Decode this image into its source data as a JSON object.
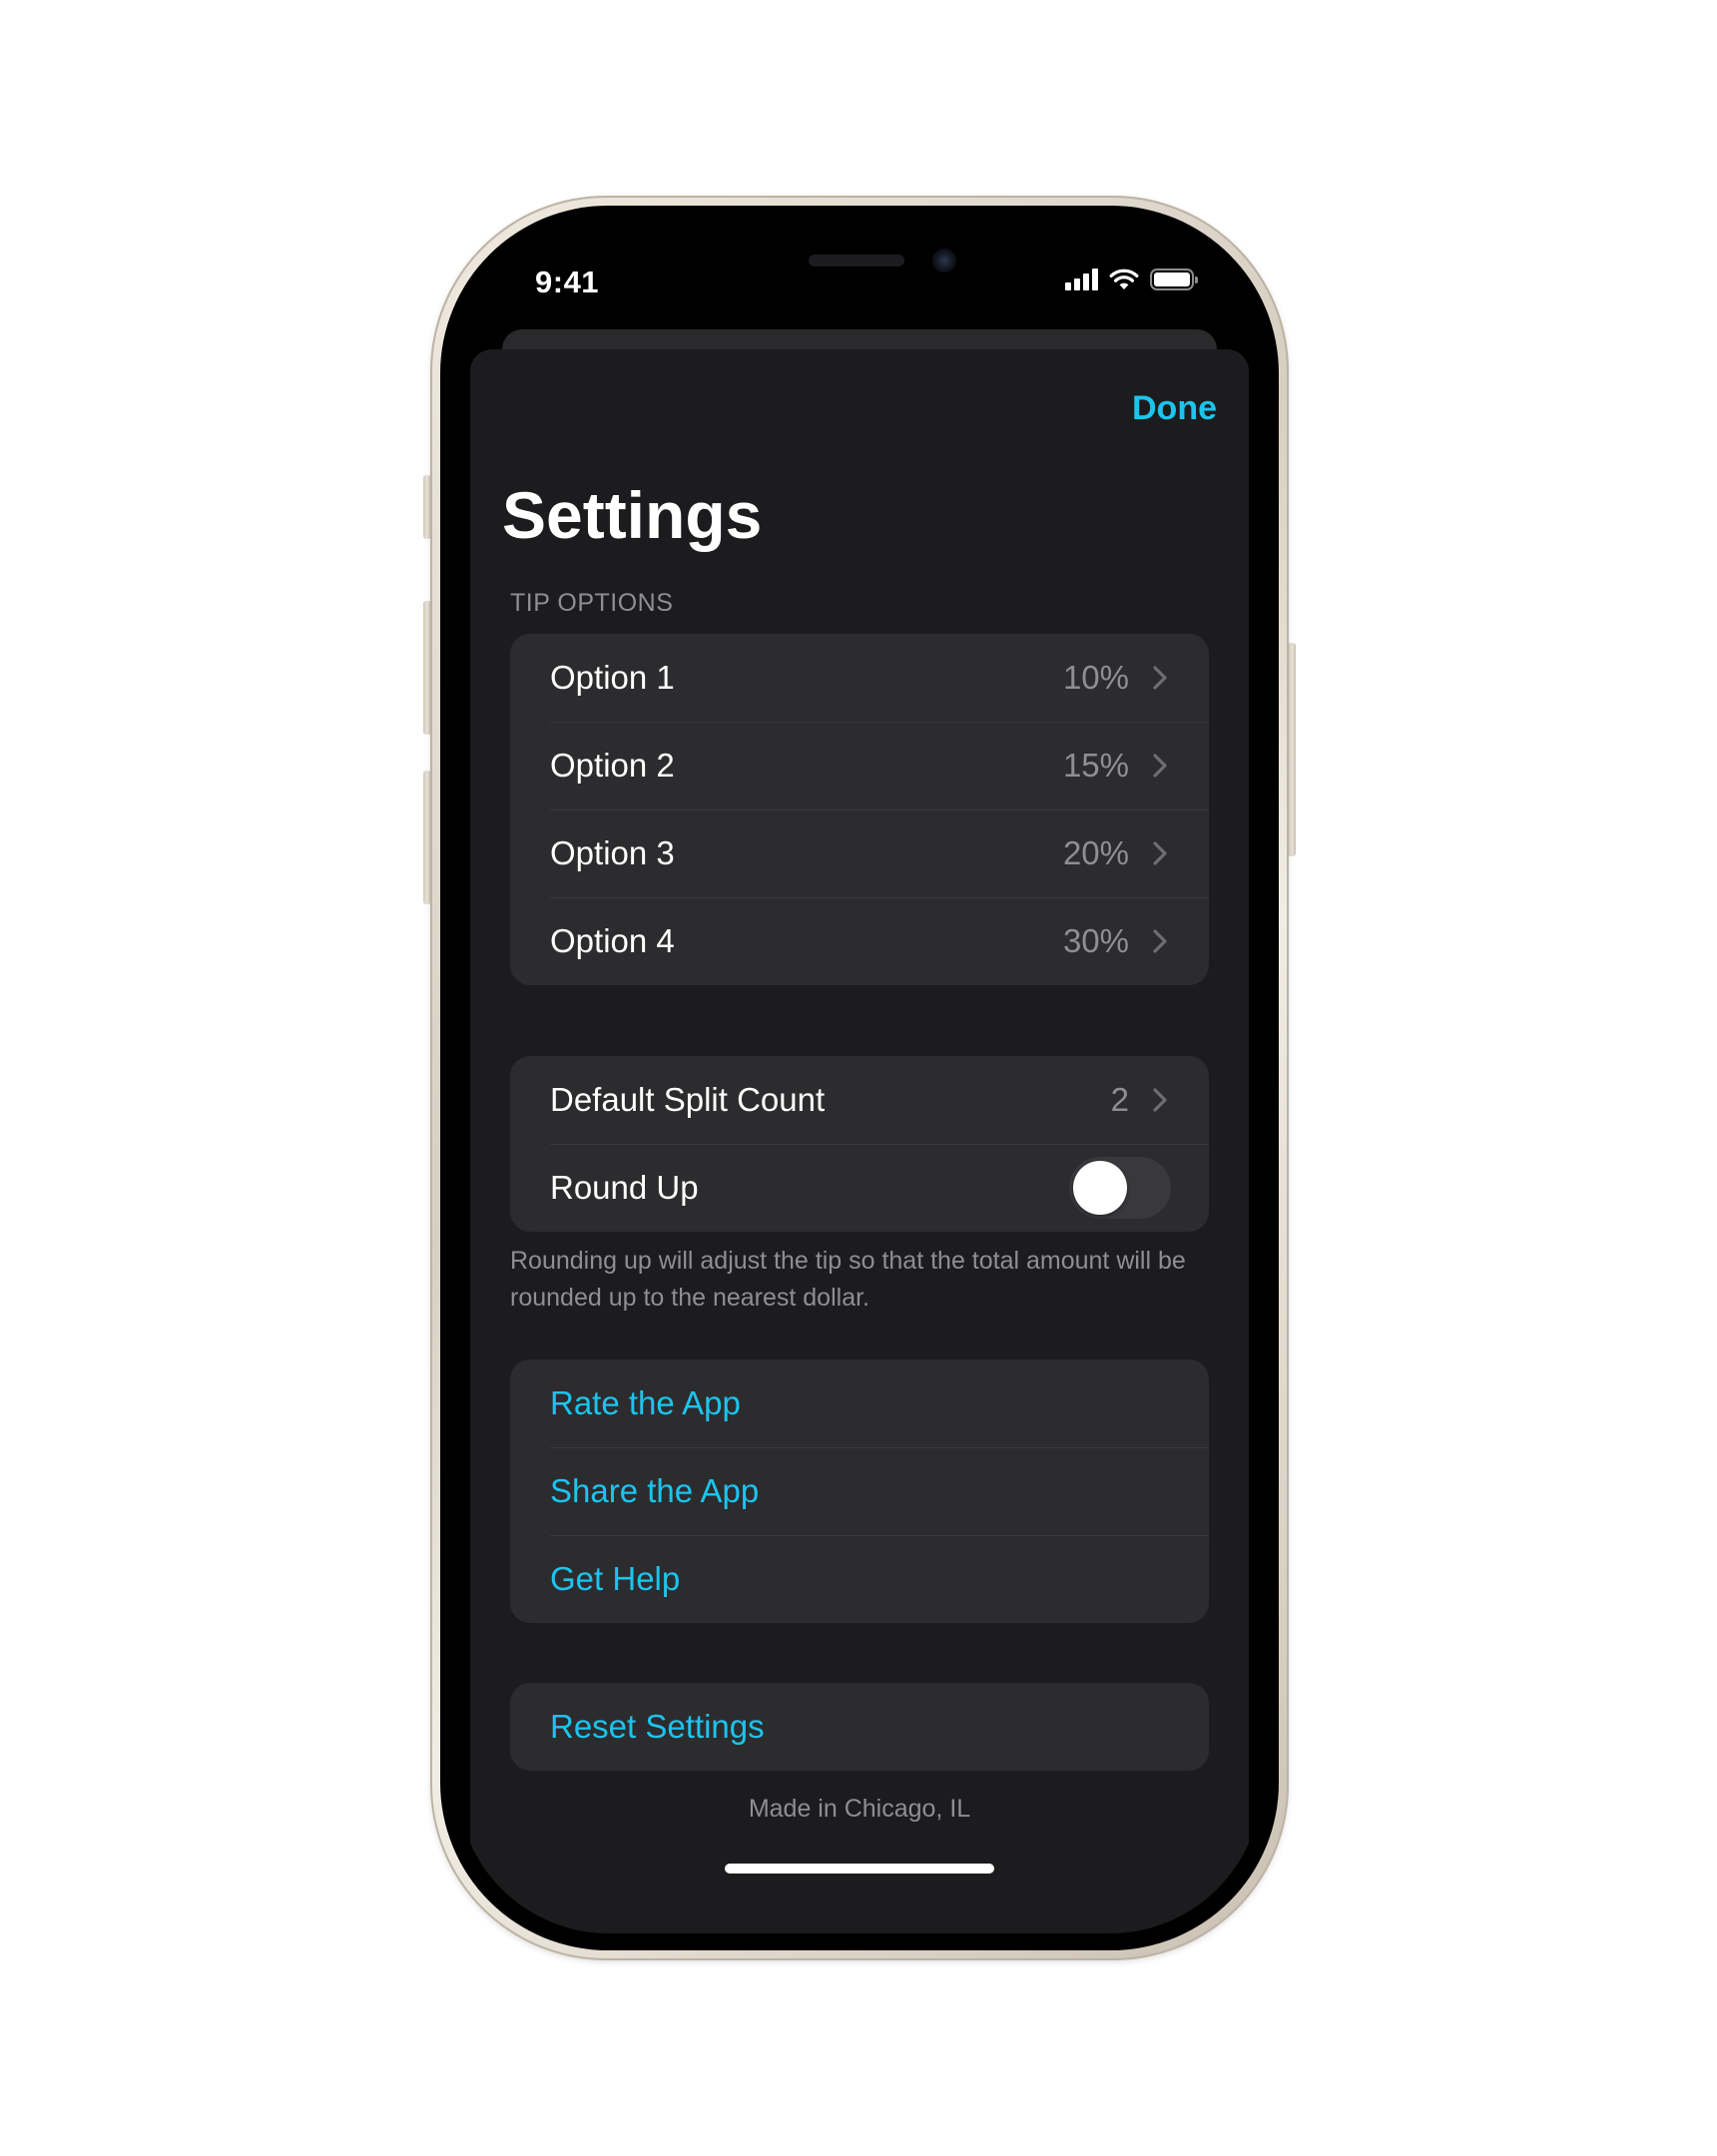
{
  "status_bar": {
    "time": "9:41",
    "signal_icon": "cellular-signal-icon",
    "wifi_icon": "wifi-icon",
    "battery_icon": "battery-full-icon"
  },
  "nav": {
    "done_label": "Done",
    "title": "Settings"
  },
  "tip_options": {
    "header": "TIP OPTIONS",
    "rows": [
      {
        "label": "Option 1",
        "value": "10%"
      },
      {
        "label": "Option 2",
        "value": "15%"
      },
      {
        "label": "Option 3",
        "value": "20%"
      },
      {
        "label": "Option 4",
        "value": "30%"
      }
    ]
  },
  "split": {
    "default_split_label": "Default Split Count",
    "default_split_value": "2",
    "round_up_label": "Round Up",
    "round_up_enabled": false,
    "footnote": "Rounding up will adjust the tip so that the total amount will be rounded up to the nearest dollar."
  },
  "links": {
    "rows": [
      {
        "label": "Rate the App"
      },
      {
        "label": "Share the App"
      },
      {
        "label": "Get Help"
      }
    ]
  },
  "reset": {
    "label": "Reset Settings"
  },
  "footer": {
    "credit": "Made in Chicago, IL"
  },
  "colors": {
    "accent": "#1cc4ee",
    "sheet_background": "#1c1c1e",
    "group_background": "#2c2c2e",
    "secondary_text": "#8e8e93"
  }
}
